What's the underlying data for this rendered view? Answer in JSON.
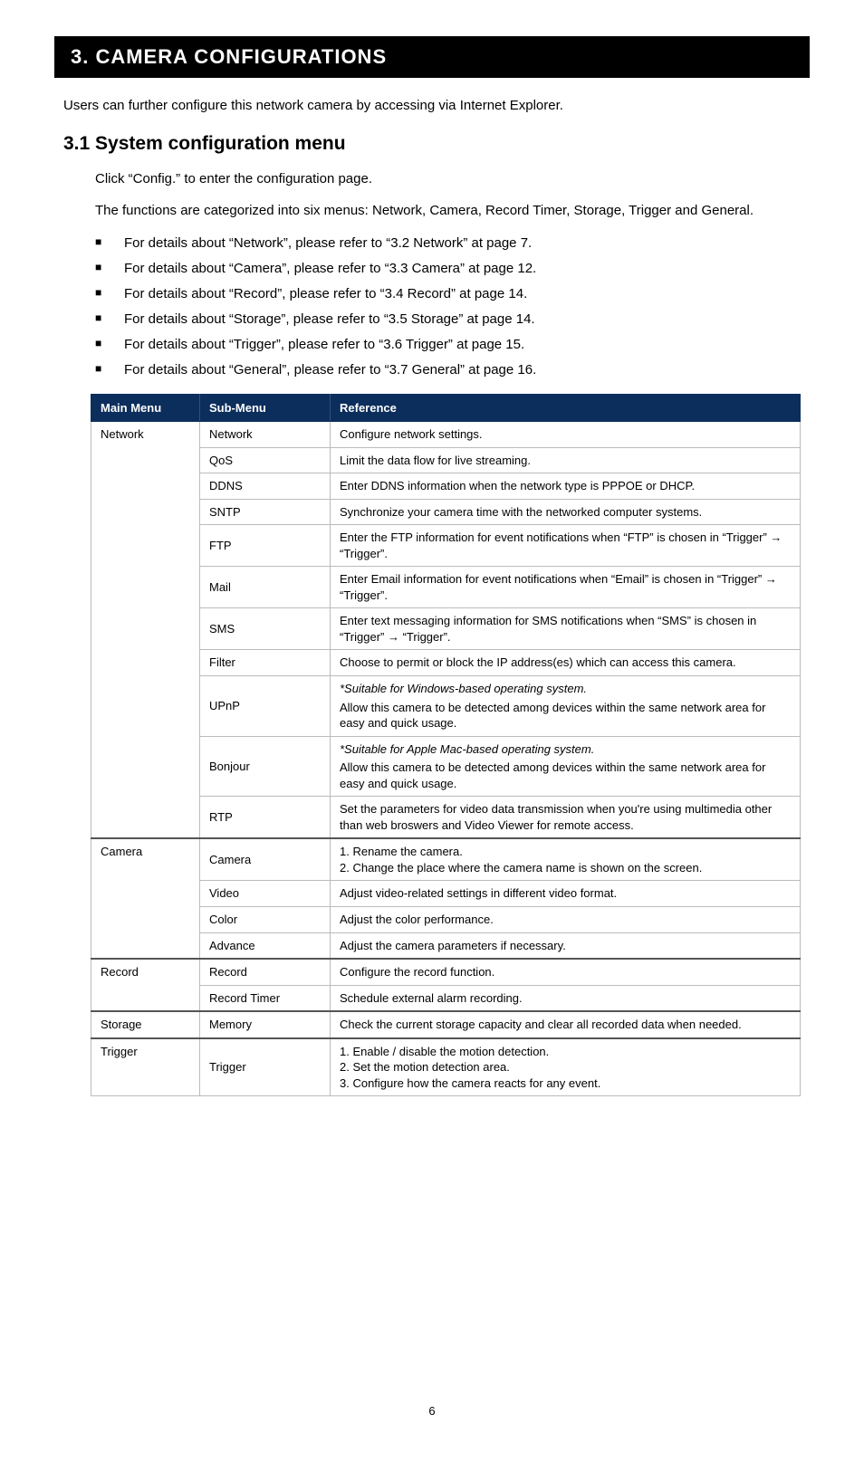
{
  "chapter_title": "3. CAMERA CONFIGURATIONS",
  "intro": "Users can further configure this network camera by accessing via Internet Explorer.",
  "section_title": "3.1 System configuration menu",
  "body1": "Click “Config.” to enter the configuration page.",
  "body2": "The functions are categorized into six menus: Network, Camera, Record Timer, Storage, Trigger and General.",
  "bullets": {
    "b0": "For details about “Network”, please refer to “3.2 Network” at page 7.",
    "b1": "For details about “Camera”, please refer to “3.3 Camera” at page 12.",
    "b2": "For details about “Record”, please refer to “3.4 Record” at page 14.",
    "b3": "For details about “Storage”, please refer to “3.5 Storage” at page 14.",
    "b4": "For details about “Trigger”, please refer to “3.6 Trigger” at page 15.",
    "b5": "For details about “General”, please refer to “3.7 General” at page 16."
  },
  "table": {
    "headers": {
      "c0": "Main Menu",
      "c1": "Sub-Menu",
      "c2": "Reference"
    },
    "main": {
      "network": "Network",
      "camera": "Camera",
      "record": "Record",
      "storage": "Storage",
      "trigger": "Trigger"
    },
    "sub": {
      "network": "Network",
      "qos": "QoS",
      "ddns": "DDNS",
      "sntp": "SNTP",
      "ftp": "FTP",
      "mail": "Mail",
      "sms": "SMS",
      "filter": "Filter",
      "upnp": "UPnP",
      "bonjour": "Bonjour",
      "rtp": "RTP",
      "camera": "Camera",
      "video": "Video",
      "color": "Color",
      "advance": "Advance",
      "record": "Record",
      "rectimer": "Record Timer",
      "memory": "Memory",
      "trigger": "Trigger"
    },
    "ref": {
      "network": "Configure network settings.",
      "qos": "Limit the data flow for live streaming.",
      "ddns": "Enter DDNS information when the network type is PPPOE or DHCP.",
      "sntp": "Synchronize your camera time with the networked computer systems.",
      "ftp": "Enter the FTP information for event notifications when “FTP” is chosen in “Trigger” → “Trigger”.",
      "mail": "Enter Email information for event notifications when “Email” is chosen in “Trigger” → “Trigger”.",
      "sms": "Enter text messaging information for SMS notifications when “SMS” is chosen in “Trigger” → “Trigger”.",
      "filter": "Choose to permit or block the IP address(es) which can access this camera.",
      "upnp_note": "*Suitable for Windows-based operating system.",
      "upnp_body": "Allow this camera to be detected among devices within the same network area for easy and quick usage.",
      "bonjour_note": "*Suitable for Apple Mac-based operating system.",
      "bonjour_body": "Allow this camera to be detected among devices within the same network area for easy and quick usage.",
      "rtp": "Set the parameters for video data transmission when you're using multimedia other than web broswers and Video Viewer for remote access.",
      "camera_l1": "1. Rename the camera.",
      "camera_l2": "2. Change the place where the camera name is shown on the screen.",
      "video": "Adjust video-related settings in different video format.",
      "color": "Adjust the color performance.",
      "advance": "Adjust the camera parameters if necessary.",
      "record": "Configure the record function.",
      "rectimer": "Schedule external alarm recording.",
      "memory": "Check the current storage capacity and clear all recorded data when needed.",
      "trigger_l1": "1. Enable / disable the motion detection.",
      "trigger_l2": "2. Set the motion detection area.",
      "trigger_l3": "3. Configure how the camera reacts for any event."
    }
  },
  "page_number": "6"
}
